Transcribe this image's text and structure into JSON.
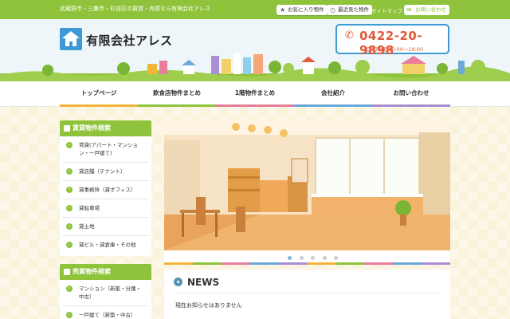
{
  "topbar": {
    "tagline": "武蔵野市・三鷹市・杉並区の賃貸・売買なら有限会社アレス",
    "favorites_label": "お気に入り物件",
    "recent_label": "最近見た物件",
    "sitemap_label": "サイトマップ",
    "contact_label": "お問い合わせ"
  },
  "header": {
    "company_name": "有限会社アレス",
    "phone": "0422-20-9898",
    "hours": "営業時間/10:00〜19:00"
  },
  "nav": {
    "items": [
      {
        "label": "トップページ"
      },
      {
        "label": "飲食店物件まとめ"
      },
      {
        "label": "1階物件まとめ"
      },
      {
        "label": "会社紹介"
      },
      {
        "label": "お問い合わせ"
      }
    ]
  },
  "sidebar": {
    "rental": {
      "title": "賃貸物件検索",
      "items": [
        {
          "label": "賃貸(アパート・マンション・一戸建て)"
        },
        {
          "label": "貸店舗（テナント）"
        },
        {
          "label": "貸事務所（貸オフィス）"
        },
        {
          "label": "貸駐車場"
        },
        {
          "label": "貸土地"
        },
        {
          "label": "貸ビル・貸倉庫・その他"
        }
      ]
    },
    "sale": {
      "title": "売買物件検索",
      "items": [
        {
          "label": "マンション（新築・分譲・中古）"
        },
        {
          "label": "一戸建て（新築・中古）"
        }
      ]
    }
  },
  "slider": {
    "current_slide": 1,
    "slide_count": 5
  },
  "news": {
    "title": "NEWS",
    "message": "現在お知らせはありません"
  },
  "colors": {
    "brand_green": "#8fc33c",
    "brand_blue": "#3d9ad4",
    "phone_red": "#e05a3b",
    "nav_bars": [
      "#f2b53a",
      "#8fc33c",
      "#e87d9c",
      "#6aa9d8",
      "#a98fd1"
    ]
  }
}
